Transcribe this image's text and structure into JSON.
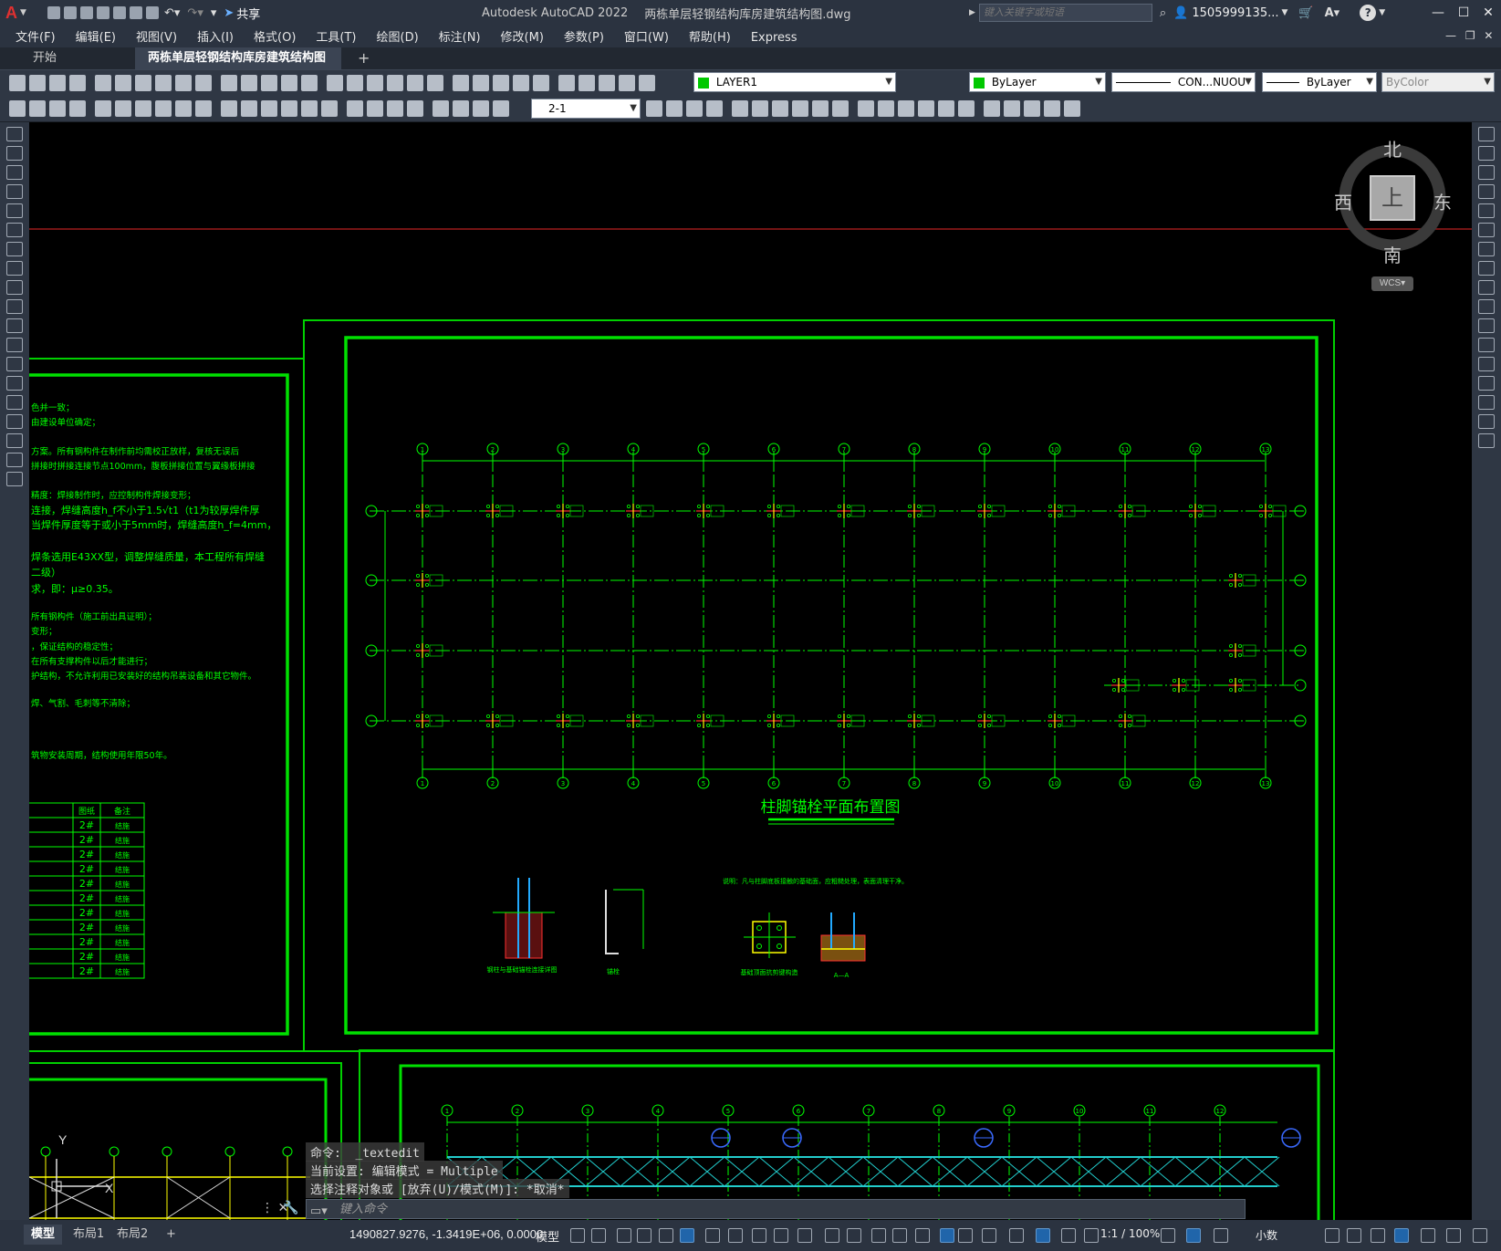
{
  "app": {
    "title": "Autodesk AutoCAD 2022",
    "filename": "两栋单层轻钢结构库房建筑结构图.dwg",
    "share_label": "共享",
    "search_placeholder": "键入关键字或短语",
    "user": "1505999135...",
    "logo_letter": "A"
  },
  "menu": [
    "文件(F)",
    "编辑(E)",
    "视图(V)",
    "插入(I)",
    "格式(O)",
    "工具(T)",
    "绘图(D)",
    "标注(N)",
    "修改(M)",
    "参数(P)",
    "窗口(W)",
    "帮助(H)",
    "Express"
  ],
  "tabs": {
    "start": "开始",
    "active_doc": "两栋单层轻钢结构库房建筑结构图*",
    "close": "✕",
    "add": "+"
  },
  "properties": {
    "layer": "LAYER1",
    "color": "ByLayer",
    "linetype": "CON...NUOU",
    "lineweight": "ByLayer",
    "plotstyle": "ByColor",
    "dimstyle": "2-1"
  },
  "viewcube": {
    "north": "北",
    "south": "南",
    "east": "东",
    "west": "西",
    "top": "上",
    "wcs": "WCS"
  },
  "drawing": {
    "plan_title": "柱脚锚栓平面布置图",
    "grid_numbers": [
      "1",
      "2",
      "3",
      "4",
      "5",
      "6",
      "7",
      "8",
      "9",
      "10",
      "11",
      "12",
      "13"
    ],
    "grid_letters": [
      "B",
      "C",
      "A"
    ],
    "lower_grid_numbers": [
      "1",
      "2",
      "3",
      "4",
      "5",
      "6",
      "7",
      "8",
      "9",
      "10",
      "11",
      "12"
    ],
    "detail_note": "说明：凡与柱脚底板接触的基础面，应粗糙处理，表面清理干净。",
    "detail_labels": [
      "钢柱与基础锚栓连接详图",
      "锚栓",
      "基础顶面抗剪键构造",
      "A—A"
    ],
    "notes": [
      "色并一致；",
      "由建设单位确定；",
      "方案。所有钢构件在制作前均需校正放样，复核无误后",
      "拼接时拼接连接节点100mm，腹板拼接位置与翼缘板拼接",
      "精度：焊接制作时，应控制构件焊接变形；",
      "连接，焊缝高度h_f不小于1.5√t1（t1为较厚焊件厚",
      "当焊件厚度等于或小于5mm时，焊缝高度h_f=4mm，",
      "焊条选用E43XX型，调整焊缝质量，本工程所有焊缝",
      "二级）",
      "求，即：μ≥0.35。",
      "所有钢构件（施工前出具证明）；",
      "变形；",
      "，保证结构的稳定性；",
      "在所有支撑构件以后才能进行；",
      "护结构，不允许利用已安装好的结构吊装设备和其它物件。",
      "焊、气割、毛刺等不清除；",
      "筑物安装周期，结构使用年限50年。"
    ],
    "table_headers": [
      "图纸",
      "备注"
    ],
    "table_rows": [
      [
        "2#",
        "结施"
      ],
      [
        "2#",
        "结施"
      ],
      [
        "2#",
        "结施"
      ],
      [
        "2#",
        "结施"
      ],
      [
        "2#",
        "结施"
      ],
      [
        "2#",
        "结施"
      ],
      [
        "2#",
        "结施"
      ],
      [
        "2#",
        "结施"
      ],
      [
        "2#",
        "结施"
      ],
      [
        "2#",
        "结施"
      ],
      [
        "2#",
        "结施"
      ]
    ]
  },
  "command": {
    "line1": "命令:  _textedit",
    "line2": "当前设置: 编辑模式 = Multiple",
    "line3": "选择注释对象或 [放弃(U)/模式(M)]: *取消*",
    "input_placeholder": "键入命令"
  },
  "status": {
    "layouts": [
      "模型",
      "布局1",
      "布局2"
    ],
    "coords": "1490827.9276, -1.3419E+06, 0.0000",
    "space": "模型",
    "scale": "1:1 / 100%",
    "units": "小数"
  },
  "colors": {
    "drawing_line": "#00ff00",
    "accent_blue": "#1e72c5",
    "canvas_bg": "#000000",
    "ui_bg": "#2b3340"
  }
}
